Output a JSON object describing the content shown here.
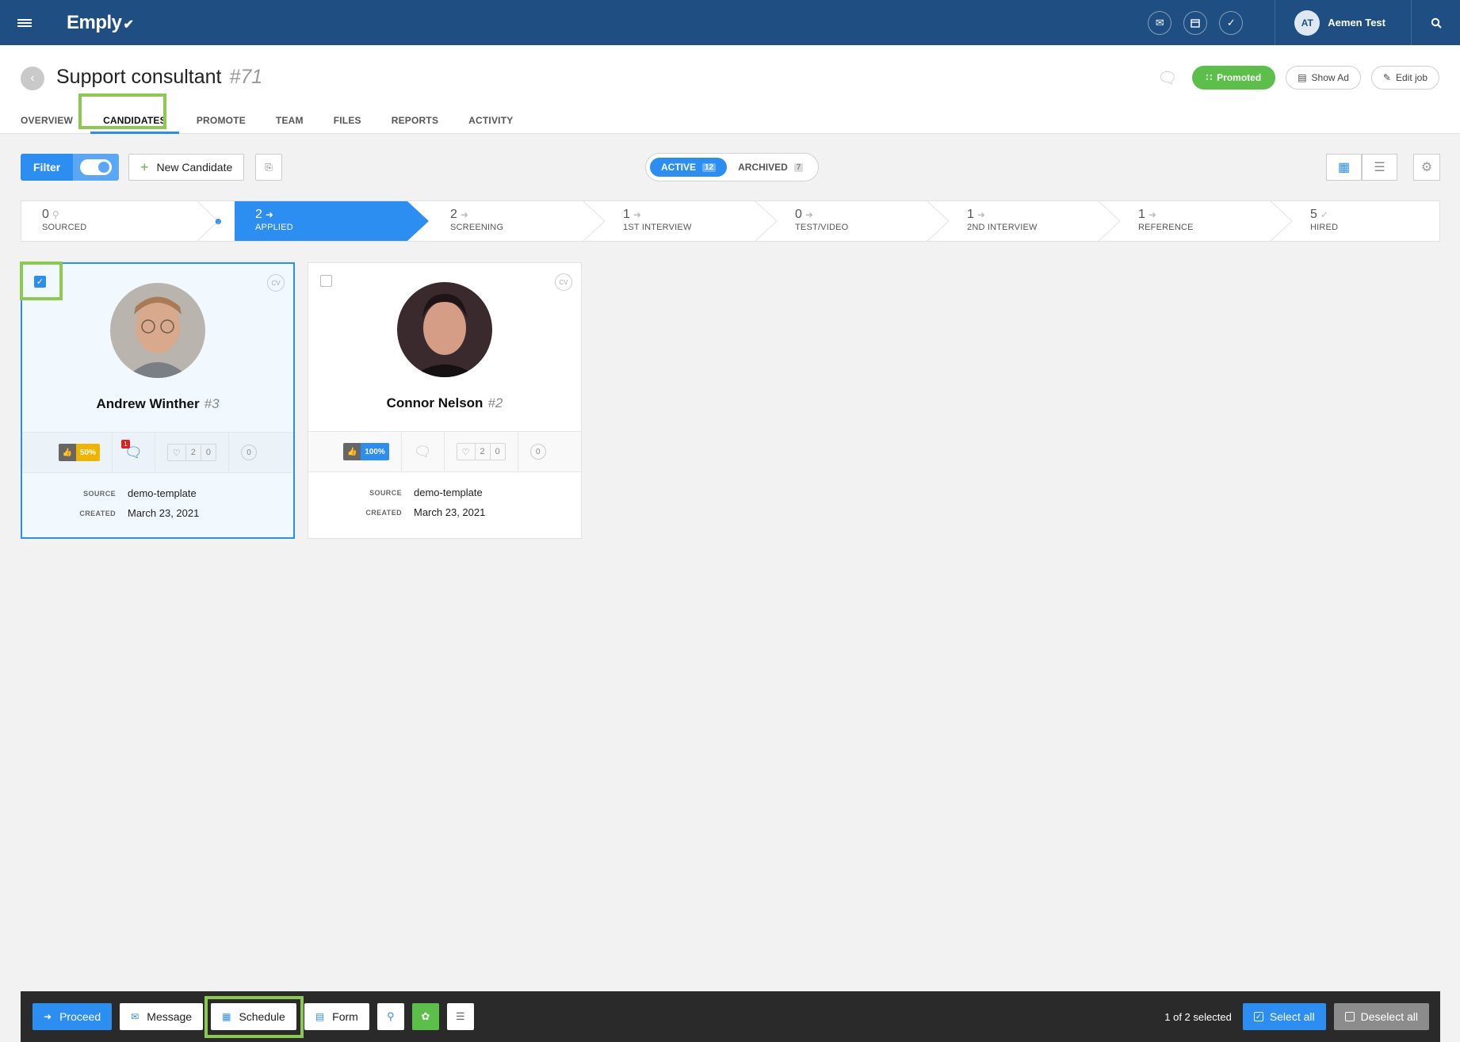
{
  "app": {
    "logo": "Emply",
    "user_initials": "AT",
    "user_name": "Aemen Test"
  },
  "job": {
    "title": "Support consultant",
    "id": "#71",
    "promoted_label": "Promoted",
    "show_ad_label": "Show Ad",
    "edit_job_label": "Edit job"
  },
  "tabs": [
    "OVERVIEW",
    "CANDIDATES",
    "PROMOTE",
    "TEAM",
    "FILES",
    "REPORTS",
    "ACTIVITY"
  ],
  "active_tab": "CANDIDATES",
  "toolbar": {
    "filter_label": "Filter",
    "new_candidate_label": "New Candidate",
    "active_label": "ACTIVE",
    "active_count": "12",
    "archived_label": "ARCHIVED",
    "archived_count": "7"
  },
  "pipeline": [
    {
      "count": "0",
      "label": "SOURCED",
      "marker": "search"
    },
    {
      "count": "2",
      "label": "APPLIED",
      "marker": "arrow",
      "active": true
    },
    {
      "count": "2",
      "label": "SCREENING",
      "marker": "arrow"
    },
    {
      "count": "1",
      "label": "1ST INTERVIEW",
      "marker": "arrow"
    },
    {
      "count": "0",
      "label": "TEST/VIDEO",
      "marker": "arrow"
    },
    {
      "count": "1",
      "label": "2ND INTERVIEW",
      "marker": "arrow"
    },
    {
      "count": "1",
      "label": "REFERENCE",
      "marker": "arrow"
    },
    {
      "count": "5",
      "label": "HIRED",
      "marker": "check"
    }
  ],
  "candidates": [
    {
      "name": "Andrew Winther",
      "id": "#3",
      "selected": true,
      "cv_label": "CV",
      "rating": "50%",
      "rating_color": "#f0b400",
      "messages_badge": "1",
      "likes": "2",
      "dislikes": "0",
      "count": "0",
      "source_key": "SOURCE",
      "source": "demo-template",
      "created_key": "CREATED",
      "created": "March 23, 2021"
    },
    {
      "name": "Connor Nelson",
      "id": "#2",
      "selected": false,
      "cv_label": "CV",
      "rating": "100%",
      "rating_color": "#2b8ef0",
      "messages_badge": "",
      "likes": "2",
      "dislikes": "0",
      "count": "0",
      "source_key": "SOURCE",
      "source": "demo-template",
      "created_key": "CREATED",
      "created": "March 23, 2021"
    }
  ],
  "bottom": {
    "proceed": "Proceed",
    "message": "Message",
    "schedule": "Schedule",
    "form": "Form",
    "selection_text": "1 of 2 selected",
    "select_all": "Select all",
    "deselect_all": "Deselect all"
  },
  "colors": {
    "topbar": "#1f4f82",
    "accent": "#2b8ef0",
    "green": "#5cbf4a",
    "highlight": "#8cc94e"
  }
}
